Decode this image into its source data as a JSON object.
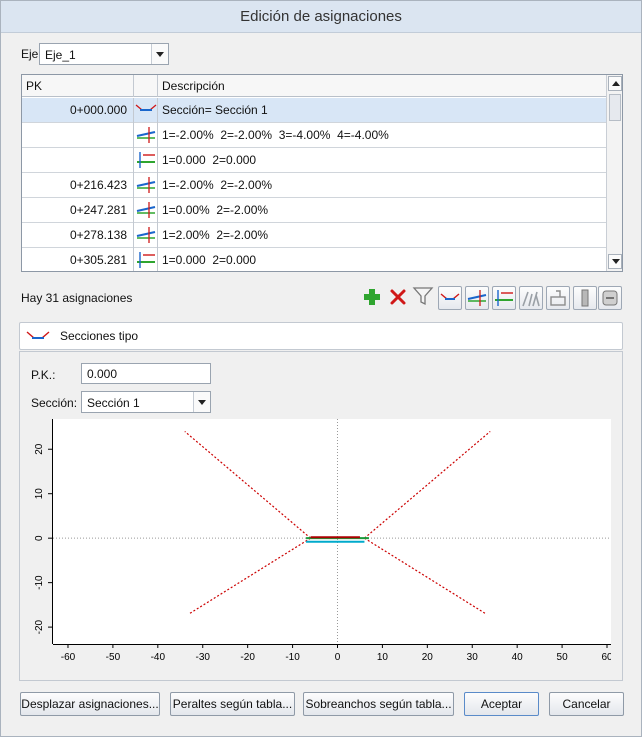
{
  "window": {
    "title": "Edición de asignaciones"
  },
  "axis_selector": {
    "label": "Eje:",
    "value": "Eje_1"
  },
  "grid": {
    "headers": {
      "pk": "PK",
      "icon": "",
      "description": "Descripción"
    },
    "rows": [
      {
        "pk": "0+000.000",
        "icon": "section-type-icon",
        "description": "Sección= Sección 1",
        "selected": true
      },
      {
        "pk": "",
        "icon": "superelevation-icon",
        "description": "1=-2.00%  2=-2.00%  3=-4.00%  4=-4.00%",
        "selected": false
      },
      {
        "pk": "",
        "icon": "widening-icon",
        "description": "1=0.000  2=0.000",
        "selected": false
      },
      {
        "pk": "0+216.423",
        "icon": "superelevation-icon",
        "description": "1=-2.00%  2=-2.00%",
        "selected": false
      },
      {
        "pk": "0+247.281",
        "icon": "superelevation-icon",
        "description": "1=0.00%  2=-2.00%",
        "selected": false
      },
      {
        "pk": "0+278.138",
        "icon": "superelevation-icon",
        "description": "1=2.00%  2=-2.00%",
        "selected": false
      },
      {
        "pk": "0+305.281",
        "icon": "widening-icon",
        "description": "1=0.000  2=0.000",
        "selected": false
      }
    ]
  },
  "status": {
    "count_text": "Hay 31 asignaciones"
  },
  "toolbar": {
    "icons": [
      "add-icon",
      "delete-icon",
      "filter-icon",
      "section-type-icon",
      "superelevation-icon",
      "widening-icon",
      "slope-icon",
      "structure-icon",
      "column-icon",
      "transfer-icon"
    ]
  },
  "section_panel": {
    "header": "Secciones tipo",
    "pk_label": "P.K.:",
    "pk_value": "0.000",
    "section_label": "Sección:",
    "section_value": "Sección 1"
  },
  "chart_data": {
    "type": "line",
    "title": "",
    "xlabel": "",
    "ylabel": "",
    "xlim": [
      -62,
      60
    ],
    "ylim": [
      -22,
      25
    ],
    "x_ticks": [
      -60,
      -50,
      -40,
      -30,
      -20,
      -10,
      0,
      10,
      20,
      30,
      40,
      50,
      60
    ],
    "y_ticks": [
      -20,
      -10,
      0,
      10,
      20
    ],
    "grid": false,
    "series": [
      {
        "color": "#cc0000",
        "style": "dotted",
        "x": [
          -6,
          -34
        ],
        "y": [
          0,
          24
        ]
      },
      {
        "color": "#cc0000",
        "style": "dotted",
        "x": [
          6,
          34
        ],
        "y": [
          0,
          24
        ]
      },
      {
        "color": "#cc0000",
        "style": "dotted",
        "x": [
          -6,
          -33
        ],
        "y": [
          0,
          -17
        ]
      },
      {
        "color": "#cc0000",
        "style": "dotted",
        "x": [
          6,
          33
        ],
        "y": [
          0,
          -17
        ]
      },
      {
        "color": "#1a9a3a",
        "style": "solid",
        "x": [
          -7,
          7
        ],
        "y": [
          0,
          0
        ]
      },
      {
        "color": "#00aacc",
        "style": "solid",
        "x": [
          -7,
          6
        ],
        "y": [
          -0.8,
          -0.8
        ]
      },
      {
        "color": "#aa0000",
        "style": "solid",
        "x": [
          -6,
          5
        ],
        "y": [
          0.2,
          0.2
        ]
      }
    ]
  },
  "footer": {
    "shift": "Desplazar asignaciones...",
    "superelevation_table": "Peraltes según tabla...",
    "widening_table": "Sobreanchos según tabla...",
    "accept": "Aceptar",
    "cancel": "Cancelar"
  },
  "colors": {
    "selection": "#d8e6f6",
    "add": "#2fa52f",
    "delete": "#d01818",
    "accent": "#5a8bc9"
  }
}
